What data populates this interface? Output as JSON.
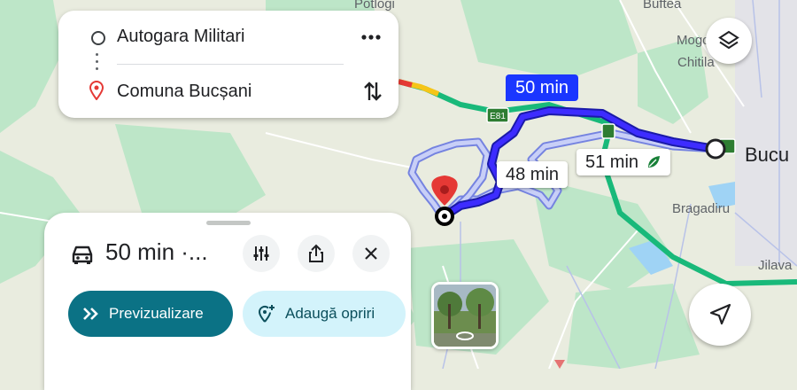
{
  "map": {
    "places": {
      "potlogi": "Potlogi",
      "buftea": "Buftea",
      "mogo": "Mogo",
      "chitila": "Chitila",
      "bucu": "Bucu",
      "bragadiru": "Bragadiru",
      "jilava": "Jilava"
    },
    "road_shield": "E81",
    "routes": {
      "selected": "50 min",
      "alt1": "48 min",
      "alt2": "51 min"
    },
    "colors": {
      "selected_route": "#1a36ff",
      "alt_route": "#aab4f5",
      "highway": "#19b97a",
      "destination_pin": "#e53935"
    }
  },
  "route_card": {
    "origin": "Autogara Militari",
    "destination": "Comuna Bucșani",
    "more_icon": "more-vertical-icon",
    "swap_icon": "swap-vertical-icon"
  },
  "sheet": {
    "summary": "50 min ·...",
    "preview_label": "Previzualizare",
    "add_stops_label": "Adaugă opriri",
    "accent": "#0b7285"
  }
}
